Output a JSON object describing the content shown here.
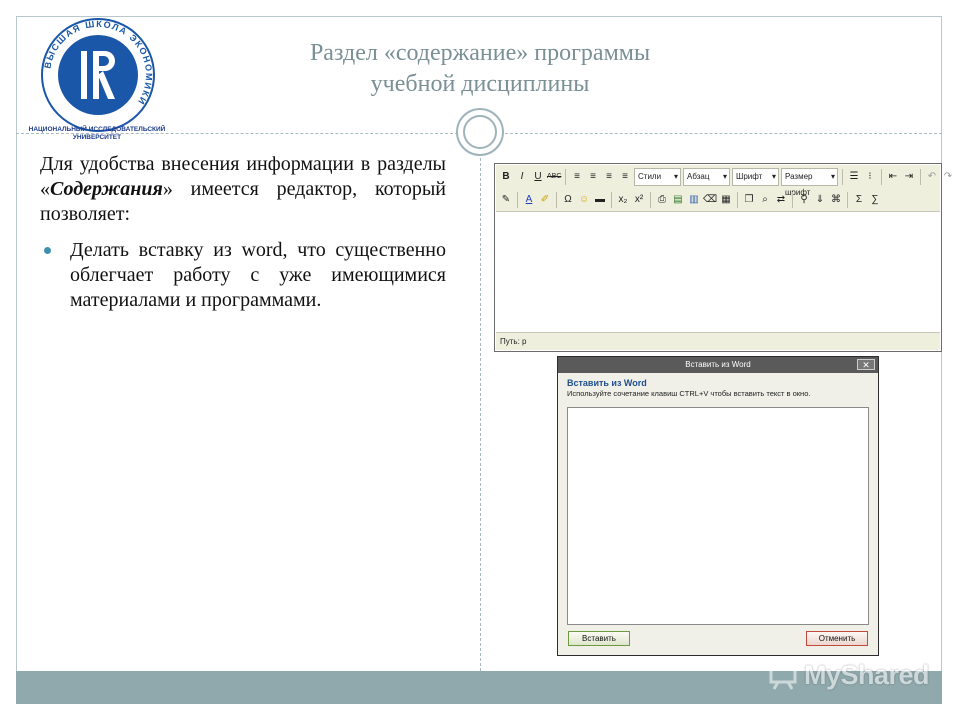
{
  "slide": {
    "title_line1": "Раздел «содержание» программы",
    "title_line2": "учебной дисциплины",
    "intro_part1": "Для удобства внесения информации в разделы «",
    "intro_em": "Содержания",
    "intro_part2": "» имеется редактор, который позволяет:",
    "bullet": "Делать вставку из word, что существенно облегчает работу с уже имеющимися материалами и программами."
  },
  "logo": {
    "ring_text": "ВЫСШАЯ ШКОЛА ЭКОНОМИКИ",
    "caption_line1": "НАЦИОНАЛЬНЫЙ ИССЛЕДОВАТЕЛЬСКИЙ",
    "caption_line2": "УНИВЕРСИТЕТ",
    "color": "#1b57a8"
  },
  "editor": {
    "row1_buttons": [
      "B",
      "I",
      "U",
      "ABC"
    ],
    "style_select": "Стили",
    "paragraph_select": "Абзац",
    "font_select": "Шрифт",
    "size_select": "Размер шрифт",
    "row2_buttons": [
      "x₂",
      "x²",
      "Ω",
      "Σ"
    ],
    "status": "Путь: p"
  },
  "dialog": {
    "title": "Вставить из Word",
    "close": "✕",
    "heading": "Вставить из Word",
    "description": "Используйте сочетание клавиш CTRL+V чтобы вставить текст в окно.",
    "insert_button": "Вставить",
    "cancel_button": "Отменить"
  },
  "watermark": {
    "text": "MyShared"
  },
  "colors": {
    "footer": "#8fa9ad",
    "title": "#7a8f96",
    "bullet": "#3f8fb0"
  }
}
